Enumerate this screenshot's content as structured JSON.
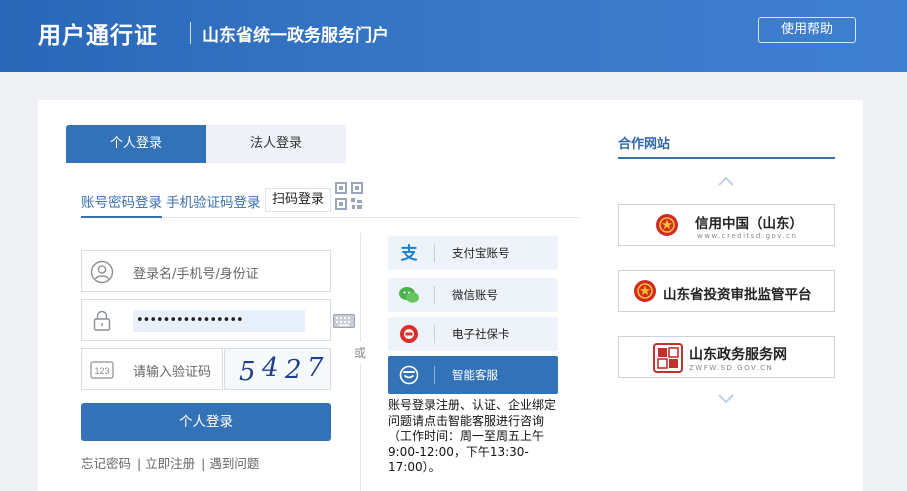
{
  "header": {
    "title": "用户通行证",
    "subtitle": "山东省统一政务服务门户",
    "help_button": "使用帮助"
  },
  "login": {
    "tabs": [
      {
        "label": "个人登录",
        "active": true
      },
      {
        "label": "法人登录",
        "active": false
      }
    ],
    "subtabs": {
      "password": "账号密码登录",
      "sms": "手机验证码登录",
      "qr": "扫码登录"
    },
    "username_placeholder": "登录名/手机号/身份证",
    "password_value": "••••••••••••••••",
    "captcha_placeholder": "请输入验证码",
    "captcha_code": [
      "5",
      "4",
      "2",
      "7"
    ],
    "submit": "个人登录",
    "links": [
      "忘记密码",
      "| 立即注册",
      "| 遇到问题"
    ],
    "or_label": "或"
  },
  "alt_logins": [
    {
      "label": "支付宝账号",
      "icon": "alipay-icon"
    },
    {
      "label": "微信账号",
      "icon": "wechat-icon"
    },
    {
      "label": "电子社保卡",
      "icon": "social-security-card-icon"
    },
    {
      "label": "智能客服",
      "icon": "customer-service-icon"
    }
  ],
  "notice": "账号登录注册、认证、企业绑定问题请点击智能客服进行咨询（工作时间：周一至周五上午9:00-12:00，下午13:30-17:00）。",
  "partners": {
    "title": "合作网站",
    "items": [
      {
        "name": "信用中国（山东）",
        "url": "www.creditsd.gov.cn"
      },
      {
        "name": "山东省投资审批监管平台",
        "url": ""
      },
      {
        "name": "山东政务服务网",
        "url": "ZWFW.SD.GOV.CN"
      }
    ]
  },
  "colors": {
    "primary": "#3472b8",
    "header_gradient_start": "#2a67b8",
    "header_gradient_end": "#3f7fcf",
    "link": "#3a6fb2"
  }
}
